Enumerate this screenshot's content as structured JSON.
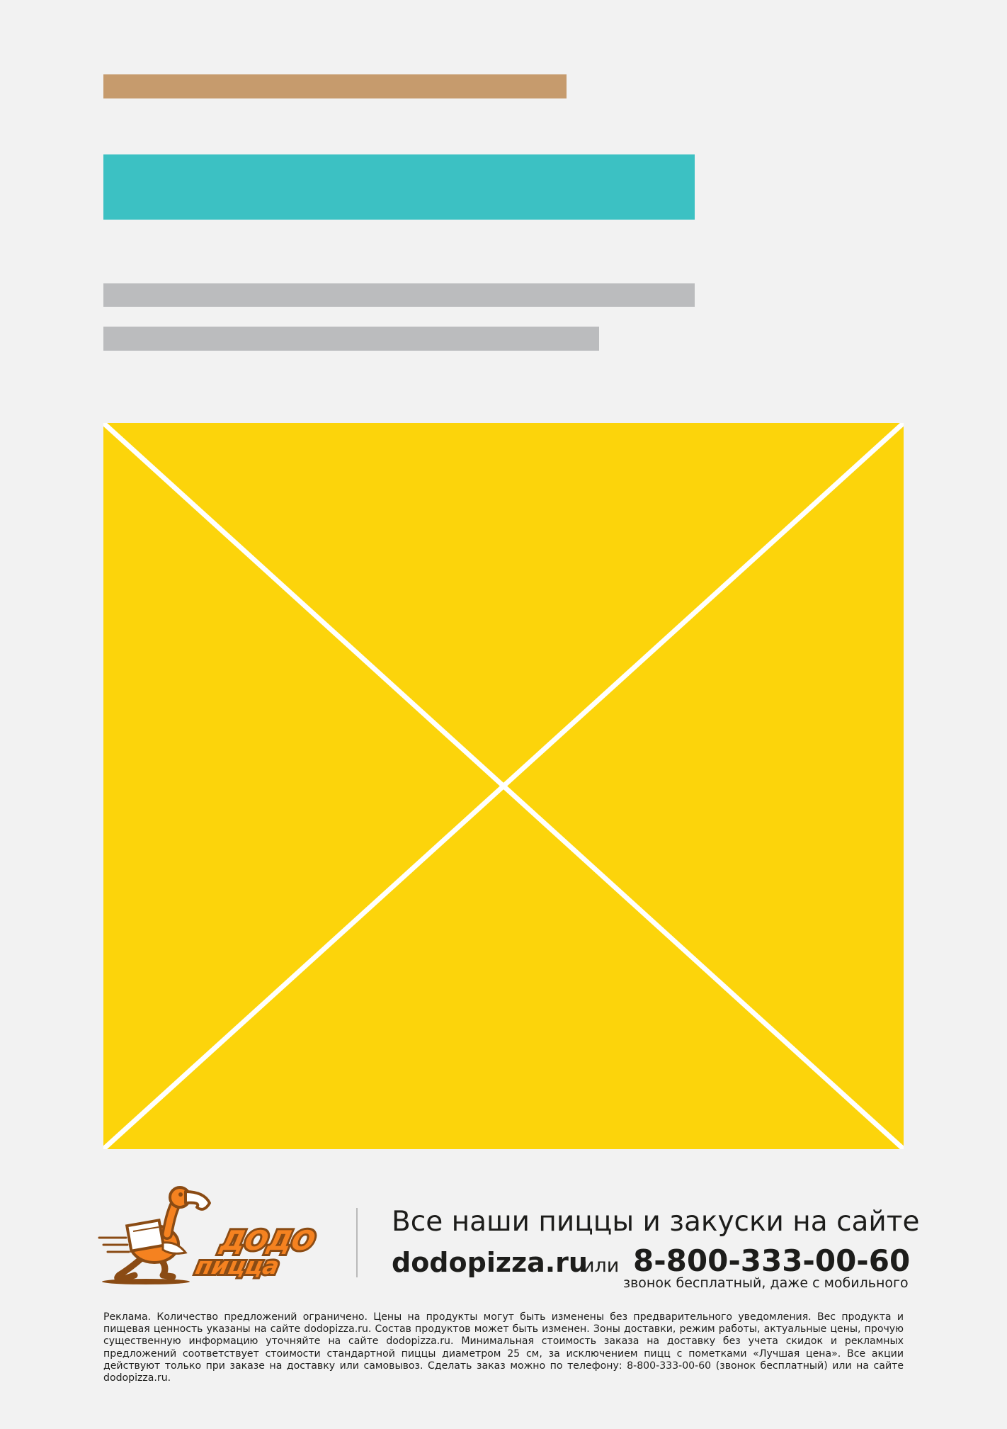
{
  "placeholders": {
    "colors": {
      "tan": "#c69b6d",
      "teal": "#3cc1c3",
      "gray": "#bbbcbe",
      "image_fill": "#fcd40b",
      "image_cross": "#ffffff"
    }
  },
  "logo": {
    "line1": "ДОДО",
    "line2": "пицца",
    "icon": "dodo-bird-courier-icon",
    "brand_orange": "#f58220",
    "brand_brown": "#8a4b14"
  },
  "footer": {
    "tagline": "Все наши пиццы и закуски на сайте",
    "site": "dodopizza.ru",
    "or": "или",
    "phone": "8-800-333-00-60",
    "phone_note": "звонок бесплатный, даже с мобильного",
    "disclaimer": "Реклама. Количество предложений ограничено. Цены на продукты могут быть изменены без предварительного уведомления. Вес продукта и пищевая ценность указаны на сайте dodopizza.ru. Состав продуктов может быть изменен. Зоны доставки, режим работы, актуальные цены, прочую существенную информацию уточняйте на сайте dodopizza.ru. Минимальная стоимость заказа на доставку без учета скидок и рекламных предложений соответствует стоимости стандартной пиццы диаметром 25 см, за исключением пицц с пометками «Лучшая цена». Все акции действуют только при заказе на доставку или самовывоз. Сделать заказ можно по телефону: 8-800-333-00-60 (звонок бесплатный) или на сайте dodopizza.ru."
  }
}
